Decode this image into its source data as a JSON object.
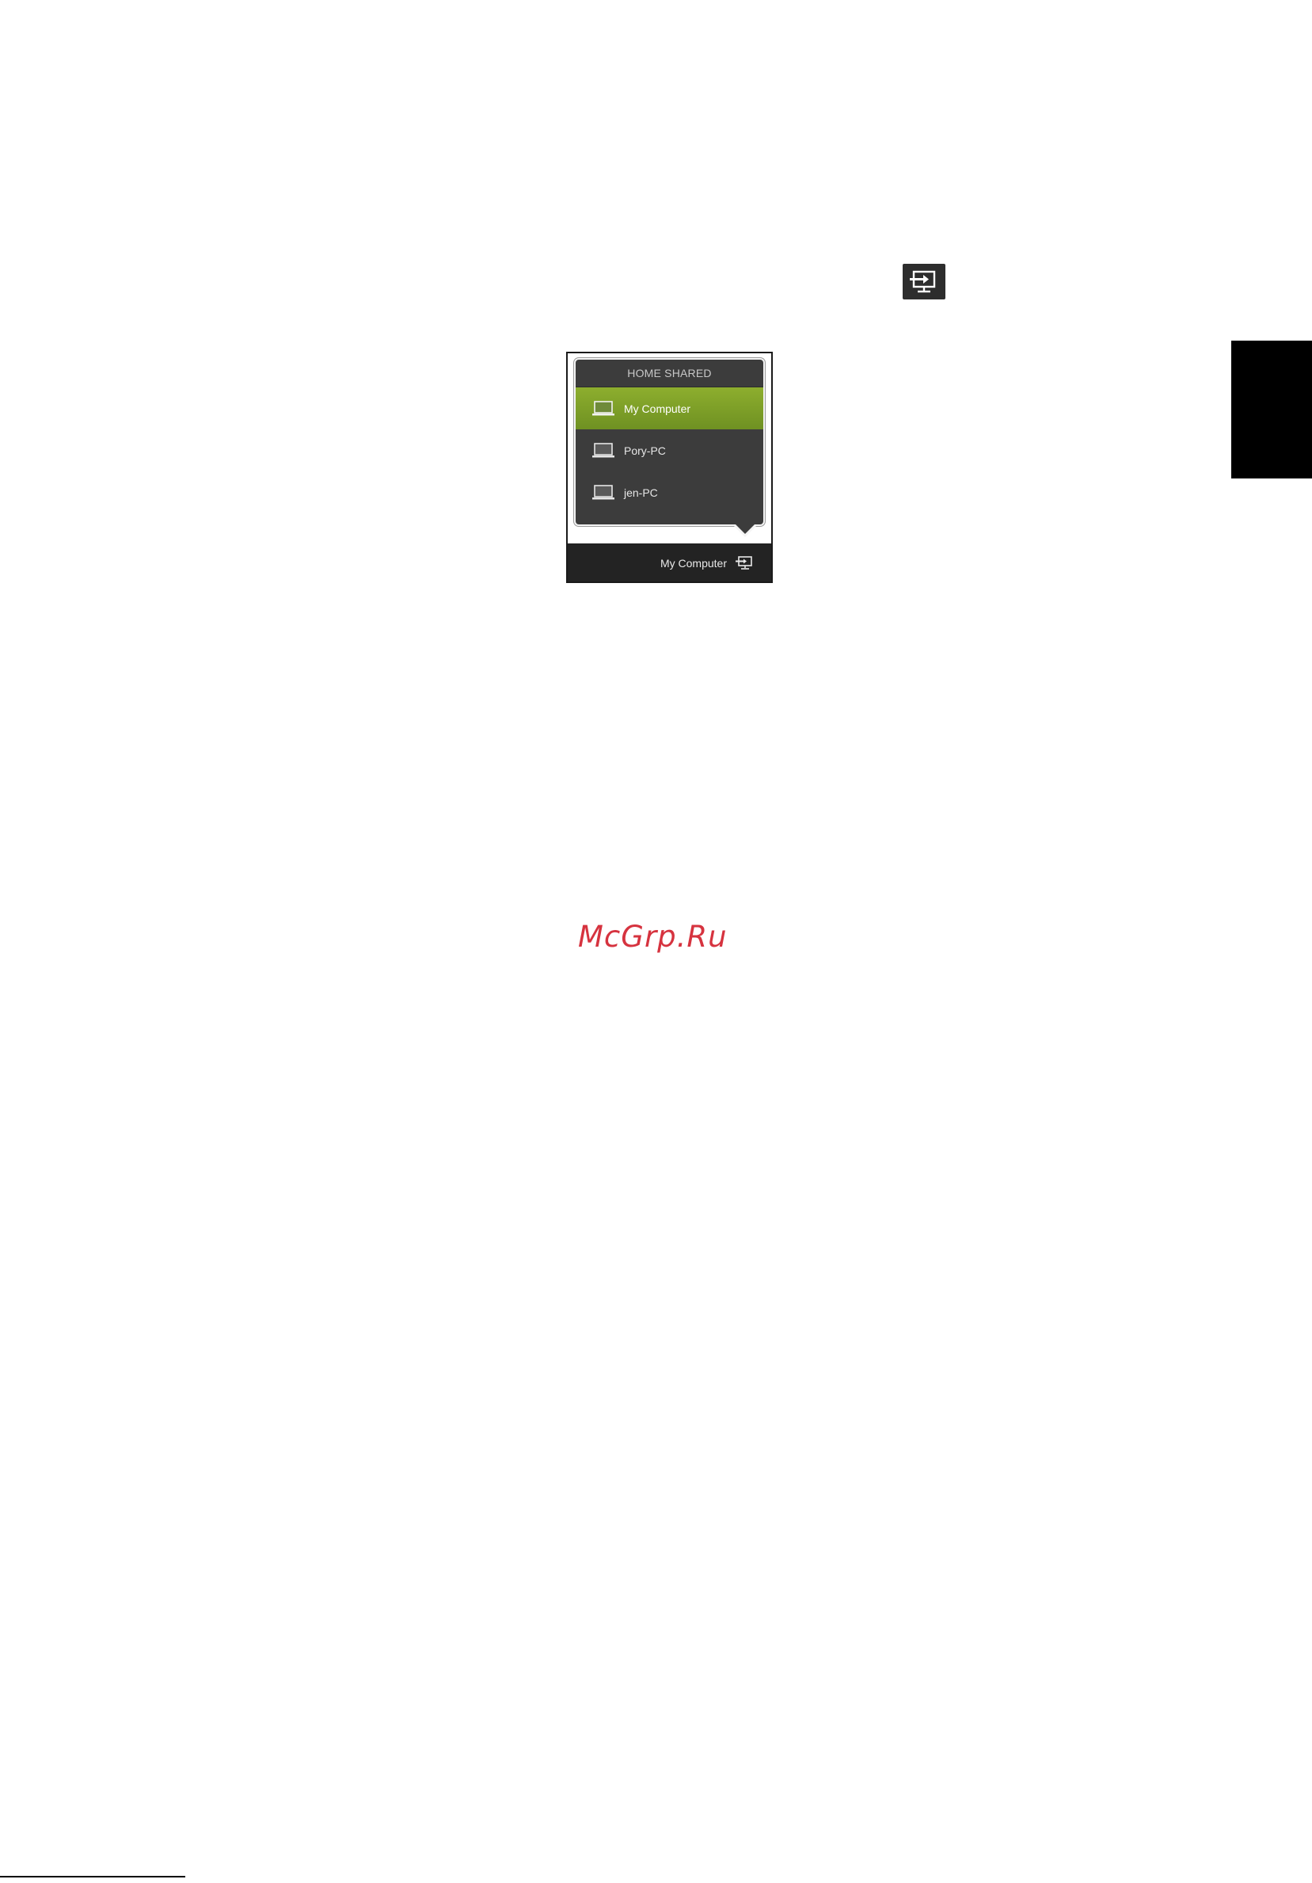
{
  "popup": {
    "header": "HOME SHARED",
    "devices": [
      {
        "label": "My Computer",
        "selected": true
      },
      {
        "label": "Pory-PC",
        "selected": false
      },
      {
        "label": "jen-PC",
        "selected": false
      }
    ]
  },
  "bottom_bar": {
    "current_device": "My Computer"
  },
  "watermark": "McGrp.Ru",
  "colors": {
    "accent": "#7a9c26",
    "popup_bg": "#3c3c3c",
    "bar_bg": "#232323",
    "watermark": "#d6333f"
  },
  "icons": {
    "inline": "play-to-icon",
    "device": "laptop-icon",
    "bar": "play-to-icon"
  }
}
